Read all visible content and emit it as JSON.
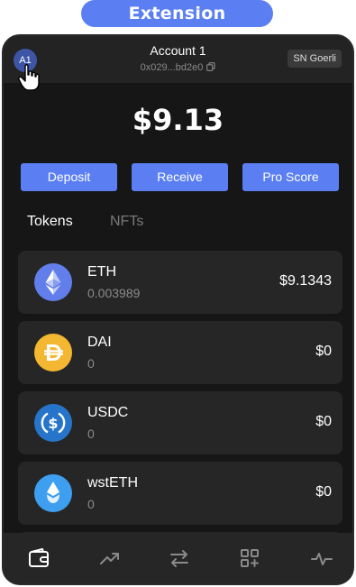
{
  "banner": {
    "label": "Extension"
  },
  "header": {
    "avatar_label": "A1",
    "account_name": "Account 1",
    "address": "0x029...bd2e0",
    "network": "SN Goerli"
  },
  "balance": "$9.13",
  "actions": {
    "deposit": "Deposit",
    "receive": "Receive",
    "pro_score": "Pro Score"
  },
  "tabs": [
    {
      "label": "Tokens",
      "active": true
    },
    {
      "label": "NFTs",
      "active": false
    }
  ],
  "tokens": [
    {
      "name": "ETH",
      "amount": "0.003989",
      "value": "$9.1343",
      "icon": "eth-icon",
      "color": "#627eea"
    },
    {
      "name": "DAI",
      "amount": "0",
      "value": "$0",
      "icon": "dai-icon",
      "color": "#f4b731"
    },
    {
      "name": "USDC",
      "amount": "0",
      "value": "$0",
      "icon": "usdc-icon",
      "color": "#2775ca"
    },
    {
      "name": "wstETH",
      "amount": "0",
      "value": "$0",
      "icon": "wsteth-icon",
      "color": "#3e9ff0"
    }
  ],
  "bottom_nav": [
    "wallet-icon",
    "trending-icon",
    "swap-icon",
    "apps-icon",
    "activity-icon"
  ]
}
